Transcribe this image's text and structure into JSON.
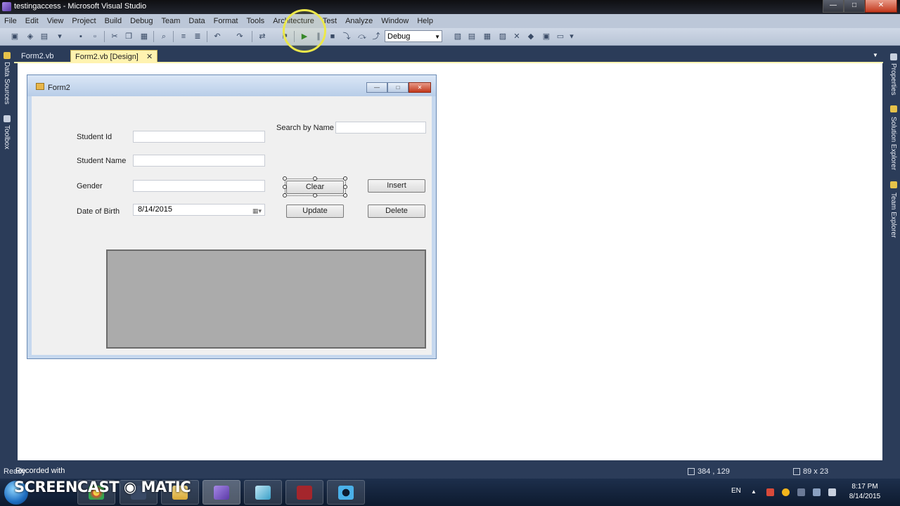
{
  "window": {
    "title": "testingaccess - Microsoft Visual Studio",
    "min": "—",
    "max": "□",
    "close": "✕"
  },
  "menu": [
    "File",
    "Edit",
    "View",
    "Project",
    "Build",
    "Debug",
    "Team",
    "Data",
    "Format",
    "Tools",
    "Architecture",
    "Test",
    "Analyze",
    "Window",
    "Help"
  ],
  "toolbar": {
    "configuration": "Debug"
  },
  "left_panel": {
    "data_sources": "Data Sources",
    "toolbox": "Toolbox"
  },
  "right_panel": {
    "properties": "Properties",
    "solution_explorer": "Solution Explorer",
    "team_explorer": "Team Explorer"
  },
  "tabs": {
    "code": "Form2.vb",
    "design": "Form2.vb [Design]",
    "close": "✕"
  },
  "form": {
    "title": "Form2",
    "labels": {
      "student_id": "Student Id",
      "student_name": "Student Name",
      "gender": "Gender",
      "dob": "Date of Birth",
      "search": "Search by Name"
    },
    "date_value": "8/14/2015",
    "buttons": {
      "clear": "Clear",
      "insert": "Insert",
      "update": "Update",
      "delete": "Delete"
    }
  },
  "status": {
    "left": "Ready",
    "position": "384 , 129",
    "size": "89 x 23"
  },
  "overlay": {
    "recorded_with": "Recorded with",
    "brand": "SCREENCAST ◉ MATIC"
  },
  "tray": {
    "lang": "EN",
    "time": "8:17 PM",
    "date": "8/14/2015"
  }
}
